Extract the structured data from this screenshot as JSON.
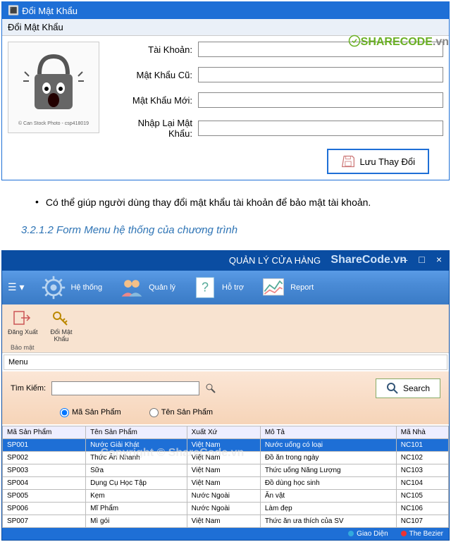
{
  "watermark1_brand": "SHARECODE",
  "watermark1_suffix": ".vn",
  "watermark2": "ShareCode.vn",
  "copyright_overlay": "Copyright © ShareCode.vn",
  "window1": {
    "title": "Đổi Mật Khẩu",
    "header": "Đổi Mật Khẩu",
    "lock_caption": "© Can Stock Photo - csp418019",
    "fields": {
      "account": "Tài Khoản:",
      "old_pw": "Mật Khẩu Cũ:",
      "new_pw": "Mật Khẩu Mới:",
      "repeat_pw": "Nhập Lại Mật Khẩu:"
    },
    "save_btn": "Lưu Thay Đổi"
  },
  "doc": {
    "bullet1": "Có thể giúp người dùng thay đổi mật khẩu tài khoản để bảo mật tài khoản.",
    "heading": "3.2.1.2 Form Menu hệ thống của chương trình"
  },
  "window2": {
    "title": "QUẢN LÝ CỬA HÀNG",
    "ribbon": {
      "system": "Hệ thống",
      "manage": "Quản lý",
      "support": "Hỗ trợ",
      "report": "Report"
    },
    "qa": {
      "logout": "Đăng Xuất",
      "change_pw": "Đổi Mật\nKhẩu",
      "group": "Bảo mật"
    },
    "menu_label": "Menu",
    "search": {
      "label": "Tìm Kiếm:",
      "radio_id": "Mã Sản Phẩm",
      "radio_name": "Tên Sản Phẩm",
      "btn": "Search"
    },
    "table": {
      "headers": [
        "Mã Sản Phẩm",
        "Tên Sản Phẩm",
        "Xuất Xứ",
        "Mô Tả",
        "Mã Nhà"
      ],
      "rows": [
        [
          "SP001",
          "Nước Giải Khát",
          "Việt Nam",
          "Nước uống có loại",
          "NC101"
        ],
        [
          "SP002",
          "Thức Ăn Nhanh",
          "Việt Nam",
          "Đồ ăn trong ngày",
          "NC102"
        ],
        [
          "SP003",
          "Sữa",
          "Việt Nam",
          "Thức uống Năng Lượng",
          "NC103"
        ],
        [
          "SP004",
          "Dụng Cụ Học Tập",
          "Việt Nam",
          "Đồ dùng học sinh",
          "NC104"
        ],
        [
          "SP005",
          "Kẹm",
          "Nước Ngoài",
          "Ăn vật",
          "NC105"
        ],
        [
          "SP006",
          "Mĩ Phẩm",
          "Nước Ngoài",
          "Làm đẹp",
          "NC106"
        ],
        [
          "SP007",
          "Mì gói",
          "Việt Nam",
          "Thức ăn ưa thích của SV",
          "NC107"
        ]
      ]
    },
    "status": {
      "item1": "Giao Diện",
      "item2": "The Bezier"
    }
  }
}
